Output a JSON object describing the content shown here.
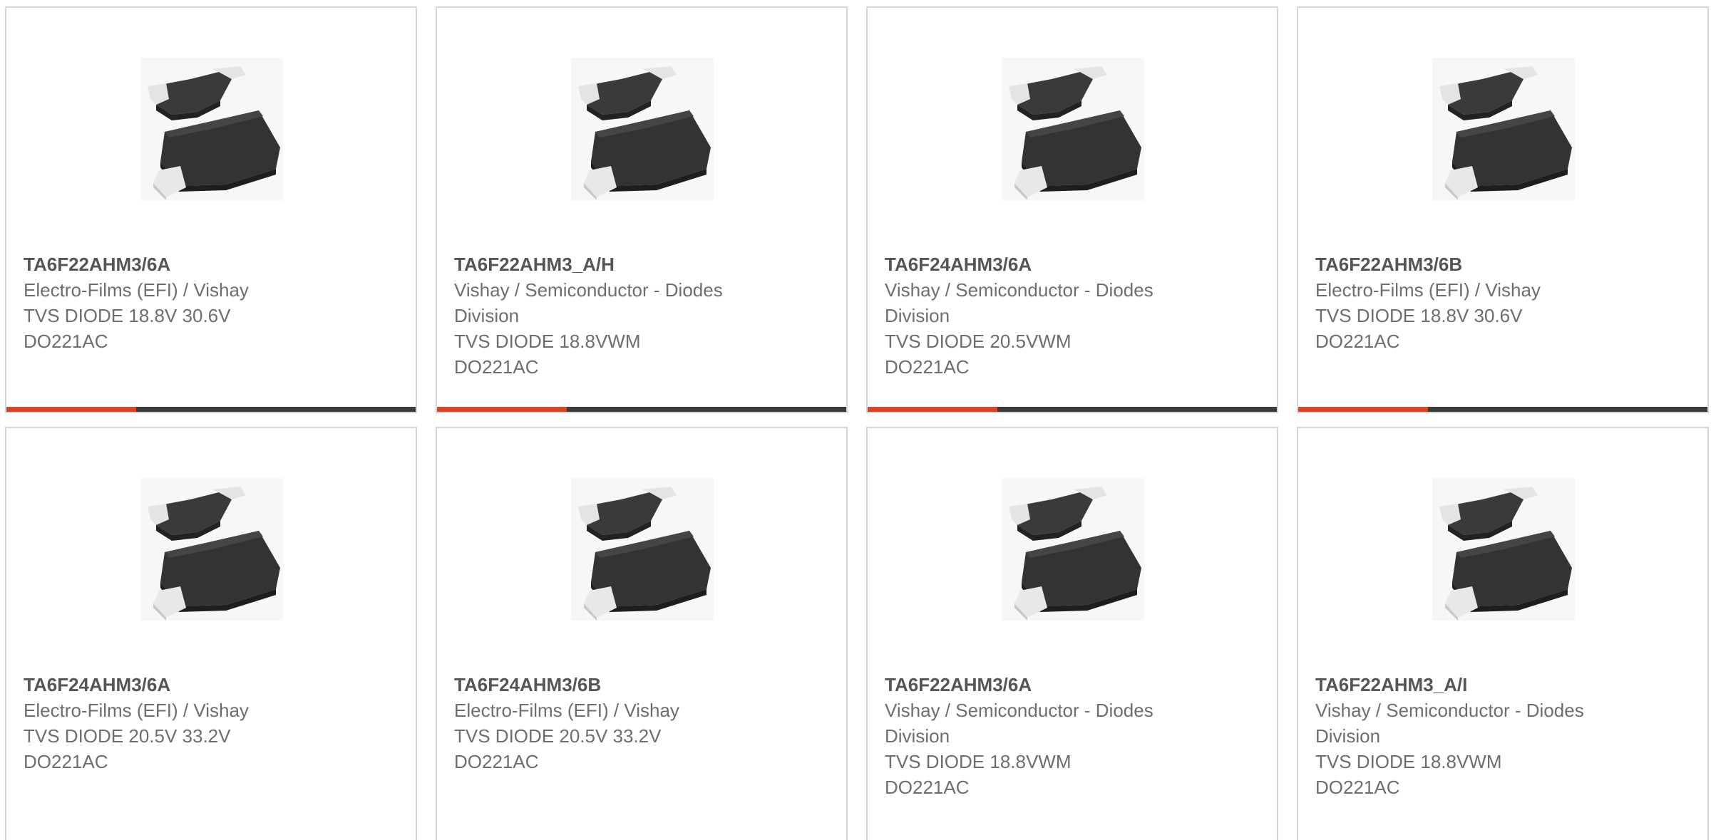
{
  "accent_color": "#e5401a",
  "bar_color": "#3b3b3b",
  "product_image_icon": "diode-package-icon",
  "products": [
    {
      "part": "TA6F22AHM3/6A",
      "manufacturer": "Electro-Films (EFI) / Vishay",
      "description": "TVS DIODE 18.8V 30.6V DO221AC"
    },
    {
      "part": "TA6F22AHM3_A/H",
      "manufacturer": "Vishay / Semiconductor - Diodes Division",
      "description": "TVS DIODE 18.8VWM DO221AC"
    },
    {
      "part": "TA6F24AHM3/6A",
      "manufacturer": "Vishay / Semiconductor - Diodes Division",
      "description": "TVS DIODE 20.5VWM DO221AC"
    },
    {
      "part": "TA6F22AHM3/6B",
      "manufacturer": "Electro-Films (EFI) / Vishay",
      "description": "TVS DIODE 18.8V 30.6V DO221AC"
    },
    {
      "part": "TA6F24AHM3/6A",
      "manufacturer": "Electro-Films (EFI) / Vishay",
      "description": "TVS DIODE 20.5V 33.2V DO221AC"
    },
    {
      "part": "TA6F24AHM3/6B",
      "manufacturer": "Electro-Films (EFI) / Vishay",
      "description": "TVS DIODE 20.5V 33.2V DO221AC"
    },
    {
      "part": "TA6F22AHM3/6A",
      "manufacturer": "Vishay / Semiconductor - Diodes Division",
      "description": "TVS DIODE 18.8VWM DO221AC"
    },
    {
      "part": "TA6F22AHM3_A/I",
      "manufacturer": "Vishay / Semiconductor - Diodes Division",
      "description": "TVS DIODE 18.8VWM DO221AC"
    }
  ]
}
